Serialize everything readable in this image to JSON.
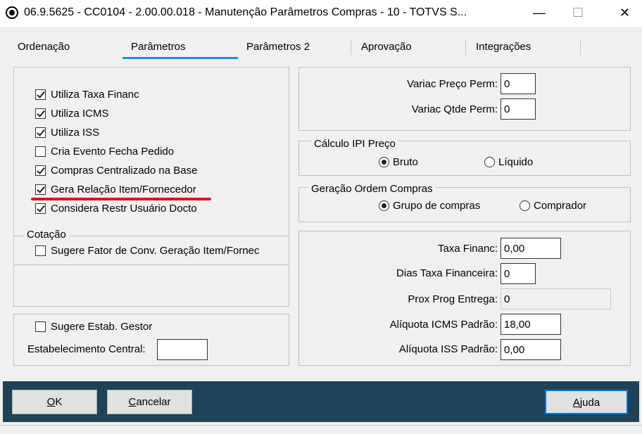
{
  "window": {
    "title": "06.9.5625 - CC0104 - 2.00.00.018 - Manutenção Parâmetros Compras - 10 - TOTVS S...",
    "minimize": "—",
    "maximize": "☐",
    "close": "✕"
  },
  "tabs": [
    {
      "label": "Ordenação"
    },
    {
      "label": "Parâmetros",
      "active": true
    },
    {
      "label": "Parâmetros 2"
    },
    {
      "label": "Aprovação"
    },
    {
      "label": "Integrações"
    }
  ],
  "left": {
    "checks": [
      {
        "label": "Utiliza Taxa Financ",
        "checked": true
      },
      {
        "label": "Utiliza ICMS",
        "checked": true
      },
      {
        "label": "Utiliza ISS",
        "checked": true
      },
      {
        "label": "Cria Evento Fecha Pedido",
        "checked": false
      },
      {
        "label": "Compras Centralizado na Base",
        "checked": true
      },
      {
        "label": "Gera Relação Item/Fornecedor",
        "checked": true
      },
      {
        "label": "Considera Restr Usuário Docto",
        "checked": true
      }
    ],
    "cotacao": {
      "legend": "Cotação",
      "check": {
        "label": "Sugere Fator de Conv. Geração Item/Fornec",
        "checked": false
      }
    },
    "gestor": {
      "check": {
        "label": "Sugere Estab. Gestor",
        "checked": false
      },
      "central_label": "Estabelecimento Central:",
      "central_value": ""
    }
  },
  "right": {
    "variac": [
      {
        "label": "Variac Preço Perm:",
        "value": "0"
      },
      {
        "label": "Variac Qtde Perm:",
        "value": "0"
      }
    ],
    "ipi": {
      "legend": "Cálculo IPI Preço",
      "options": [
        {
          "label": "Bruto",
          "selected": true
        },
        {
          "label": "Líquido",
          "selected": false
        }
      ]
    },
    "ordem": {
      "legend": "Geração Ordem Compras",
      "options": [
        {
          "label": "Grupo de compras",
          "selected": true
        },
        {
          "label": "Comprador",
          "selected": false
        }
      ]
    },
    "fields": [
      {
        "label": "Taxa Financ:",
        "value": "0,00"
      },
      {
        "label": "Dias Taxa Financeira:",
        "value": "0"
      },
      {
        "label": "Prox Prog Entrega:",
        "value": "0",
        "readonly": true
      },
      {
        "label": "Alíquota ICMS Padrão:",
        "value": "18,00"
      },
      {
        "label": "Alíquota ISS Padrão:",
        "value": "0,00"
      }
    ]
  },
  "buttons": {
    "ok": {
      "pre": "",
      "u": "O",
      "post": "K"
    },
    "cancel": {
      "pre": "",
      "u": "C",
      "post": "ancelar"
    },
    "help": {
      "pre": "",
      "u": "A",
      "post": "juda"
    }
  },
  "colors": {
    "accent": "#1a91d6",
    "highlight": "#e4111c",
    "footer": "#1f4256"
  }
}
